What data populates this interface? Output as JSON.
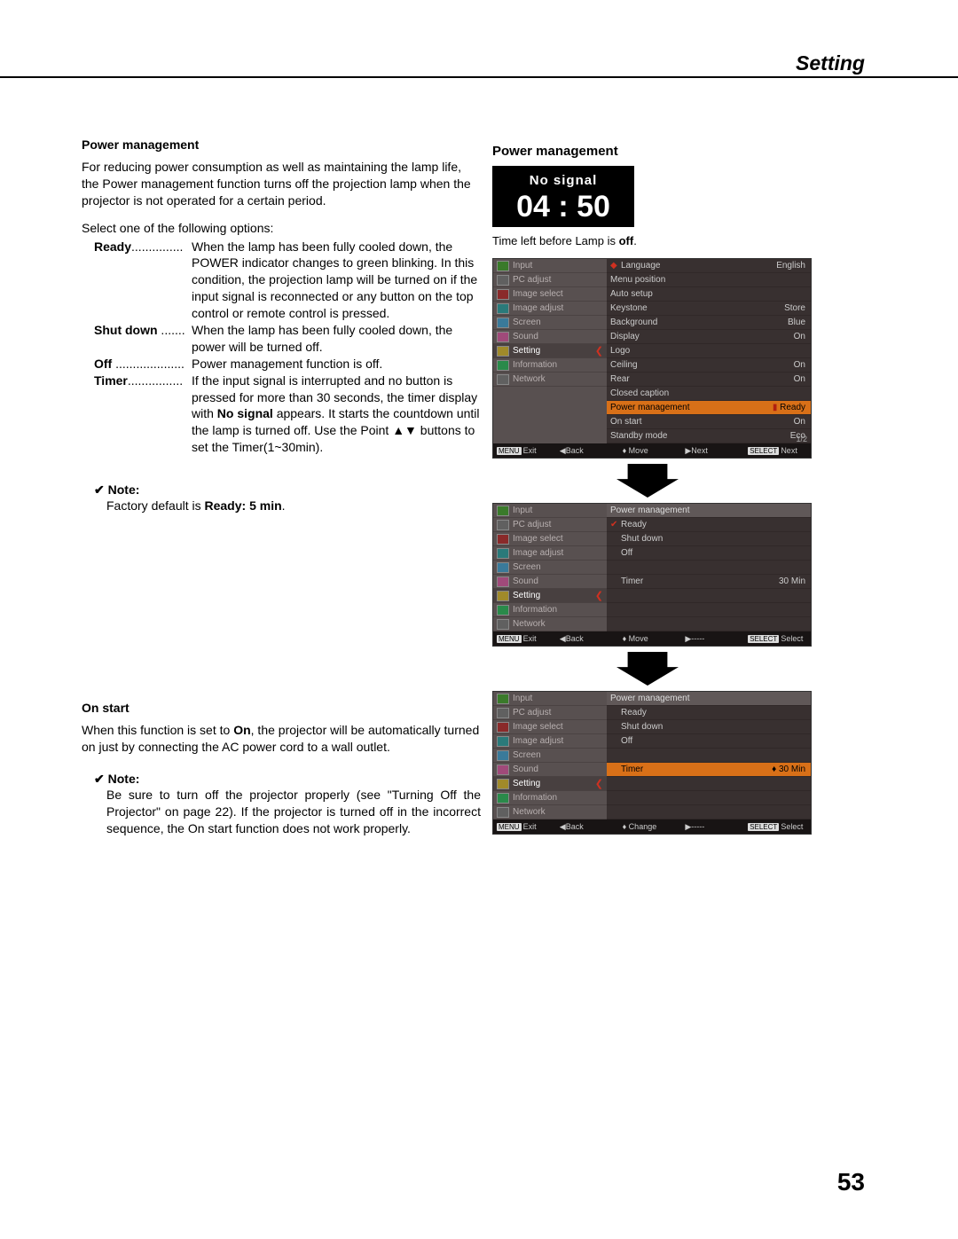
{
  "page_title": "Setting",
  "page_number": "53",
  "left": {
    "pm_heading": "Power management",
    "pm_intro": "For reducing power consumption as well as maintaining the lamp life, the Power management function turns off the projection lamp when the projector is not operated for a certain period.",
    "select_line": "Select one of the following options:",
    "defs": {
      "ready_term": "Ready",
      "ready_dots": "...............",
      "ready_body": "When the lamp has been fully cooled down, the POWER indicator changes to green blinking. In this condition, the projection lamp will be turned on if the input signal is reconnected or any button on the top control or remote control is pressed.",
      "shutdown_term": "Shut down",
      "shutdown_dots": " .......",
      "shutdown_body": "When the lamp has been fully cooled down, the power will be turned off.",
      "off_term": "Off",
      "off_dots": " ....................",
      "off_body": "Power management function is off.",
      "timer_term": "Timer",
      "timer_dots": "................",
      "timer_body_pre": "If the input signal is interrupted and no button is pressed for more than 30 seconds, the timer display with ",
      "timer_body_bold": "No signal",
      "timer_body_post": " appears. It starts the countdown until the lamp is turned off. Use the Point ▲▼ buttons to set the Timer(1~30min)."
    },
    "note1_label": "✔ Note:",
    "note1_body_pre": "Factory default is ",
    "note1_body_bold": "Ready: 5 min",
    "note1_body_post": ".",
    "onstart_heading": "On start",
    "onstart_body_pre": "When this function is set to ",
    "onstart_body_bold": "On",
    "onstart_body_post": ", the projector will be automatically turned on just by connecting the AC power cord to a wall outlet.",
    "note2_label": "✔ Note:",
    "note2_body": "Be sure to turn off the projector properly (see \"Turning Off the Projector\" on page 22). If the projector is turned off in the incorrect sequence, the On start function does not work properly."
  },
  "right": {
    "heading": "Power management",
    "nosignal_title": "No signal",
    "nosignal_time": "04 : 50",
    "caption_pre": "Time left before Lamp is ",
    "caption_bold": "off",
    "caption_post": ".",
    "sidebar_items": [
      {
        "label": "Input",
        "icon": "ic-green"
      },
      {
        "label": "PC adjust",
        "icon": "ic-gry"
      },
      {
        "label": "Image select",
        "icon": "ic-red"
      },
      {
        "label": "Image adjust",
        "icon": "ic-teal"
      },
      {
        "label": "Screen",
        "icon": "ic-cyan"
      },
      {
        "label": "Sound",
        "icon": "ic-pink"
      },
      {
        "label": "Setting",
        "icon": "ic-yel"
      },
      {
        "label": "Information",
        "icon": "ic-grn2"
      },
      {
        "label": "Network",
        "icon": "ic-gry"
      }
    ],
    "osd1": {
      "rows": [
        {
          "label": "Language",
          "val": "English",
          "mark": true
        },
        {
          "label": "Menu position",
          "val": ""
        },
        {
          "label": "Auto setup",
          "val": ""
        },
        {
          "label": "Keystone",
          "val": "Store"
        },
        {
          "label": "Background",
          "val": "Blue"
        },
        {
          "label": "Display",
          "val": "On"
        },
        {
          "label": "Logo",
          "val": ""
        },
        {
          "label": "Ceiling",
          "val": "On"
        },
        {
          "label": "Rear",
          "val": "On"
        },
        {
          "label": "Closed caption",
          "val": ""
        },
        {
          "label": "Power management",
          "val": "Ready",
          "hl": true,
          "markred": true
        },
        {
          "label": "On start",
          "val": "On"
        },
        {
          "label": "Standby mode",
          "val": "Eco"
        }
      ],
      "page": "1/2",
      "foot": [
        "MENU Exit",
        "◀Back",
        "♦ Move",
        "▶Next",
        "SELECT Next"
      ]
    },
    "osd2": {
      "header": "Power management",
      "rows": [
        {
          "label": "Ready",
          "checked": true
        },
        {
          "label": "Shut down"
        },
        {
          "label": "Off"
        },
        {
          "label": ""
        },
        {
          "label": "Timer",
          "val": "30 Min"
        }
      ],
      "foot": [
        "MENU Exit",
        "◀Back",
        "♦ Move",
        "▶-----",
        "SELECT Select"
      ]
    },
    "osd3": {
      "header": "Power management",
      "rows": [
        {
          "label": "Ready"
        },
        {
          "label": "Shut down"
        },
        {
          "label": "Off"
        },
        {
          "label": ""
        },
        {
          "label": "Timer",
          "val": "30 Min",
          "hl": true,
          "spin": "♦"
        }
      ],
      "foot": [
        "MENU Exit",
        "◀Back",
        "♦ Change",
        "▶-----",
        "SELECT Select"
      ]
    }
  }
}
